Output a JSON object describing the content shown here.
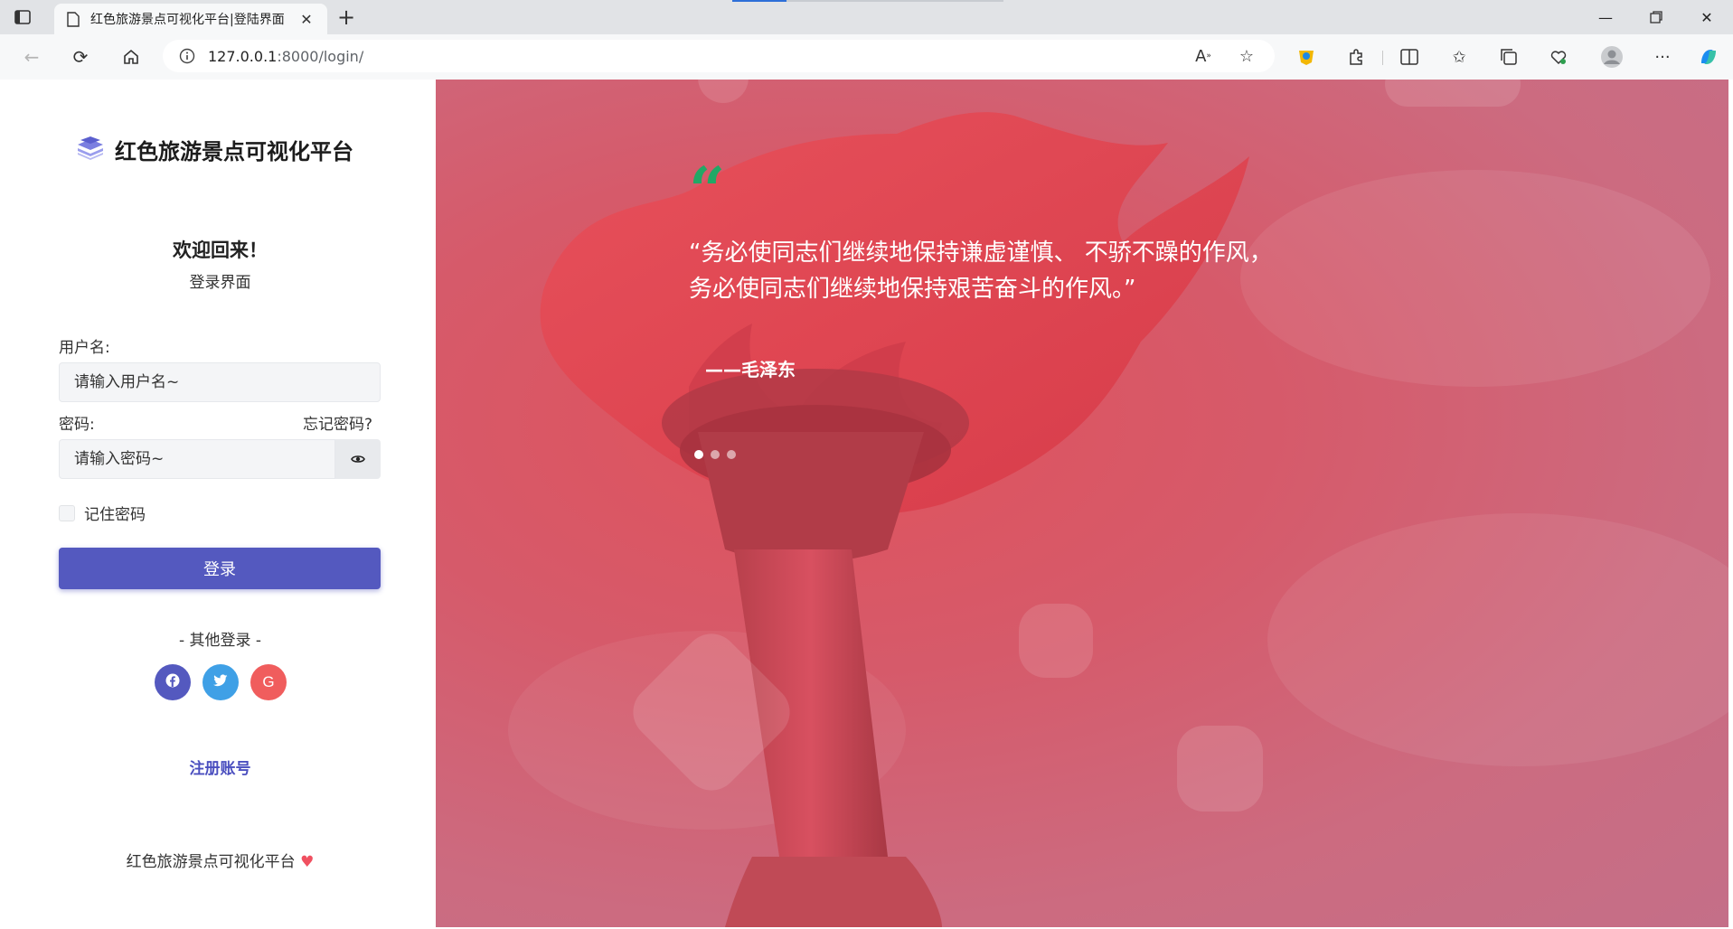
{
  "browser": {
    "tab_title": "红色旅游景点可视化平台|登陆界面",
    "url_host": "127.0.0.1",
    "url_rest": ":8000/login/"
  },
  "brand": {
    "name": "红色旅游景点可视化平台"
  },
  "login": {
    "welcome": "欢迎回来！",
    "subtitle": "登录界面",
    "username_label": "用户名:",
    "username_placeholder": "请输入用户名~",
    "password_label": "密码:",
    "forgot_link": "忘记密码?",
    "password_placeholder": "请输入密码~",
    "remember_label": "记住密码",
    "submit_label": "登录",
    "other_login": "- 其他登录 -",
    "social": [
      {
        "name": "facebook-icon",
        "glyph": "f",
        "color": "#5459bf"
      },
      {
        "name": "twitter-icon",
        "glyph": "t",
        "color": "#3fa0e6"
      },
      {
        "name": "google-icon",
        "glyph": "G",
        "color": "#f05d5d"
      }
    ],
    "register_link": "注册账号",
    "footer_text": "红色旅游景点可视化平台"
  },
  "hero": {
    "quote_mark": "“",
    "quote_line1": "“务必使同志们继续地保持谦虚谨慎、 不骄不躁的作风，",
    "quote_line2": "务必使同志们继续地保持艰苦奋斗的作风。”",
    "author": "——毛泽东",
    "slides_total": 3,
    "slide_active": 1
  },
  "colors": {
    "primary": "#5459bf",
    "quote_accent": "#22a866",
    "overlay": "#d65a6a"
  }
}
